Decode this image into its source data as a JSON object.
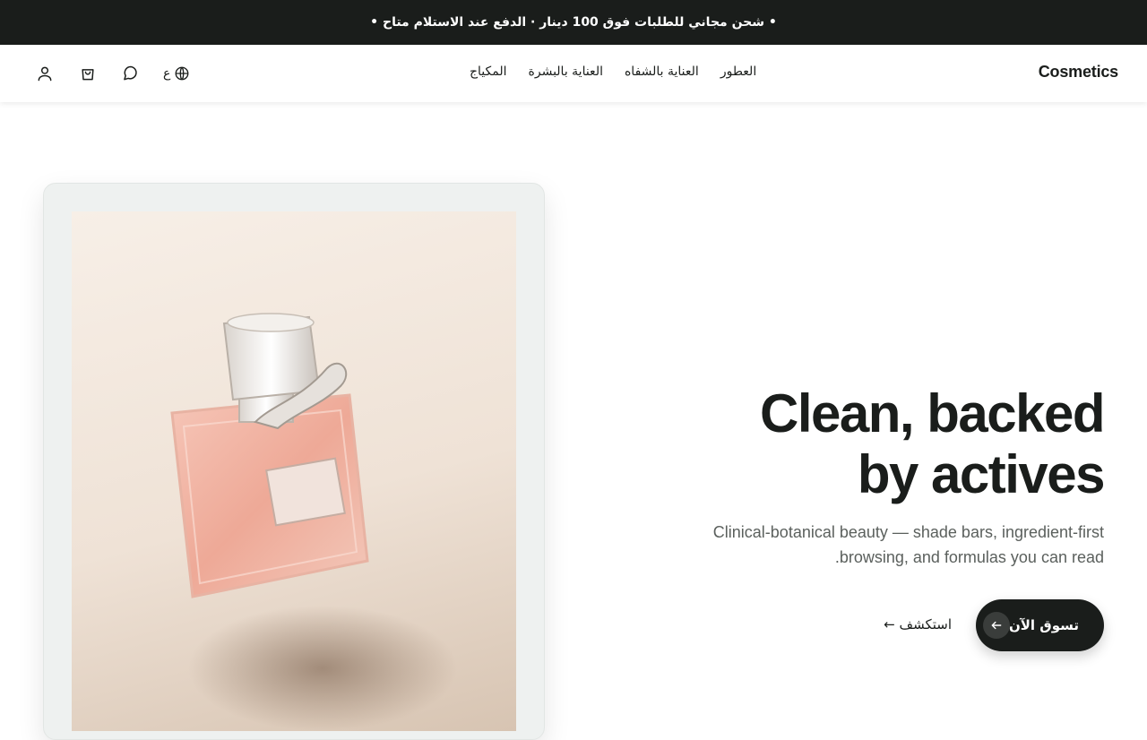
{
  "announcement": "• شحن مجاني للطلبات فوق 100 دينار · الدفع عند الاستلام متاح •",
  "brand": "Cosmetics",
  "nav": {
    "makeup": "المكياج",
    "skincare": "العناية بالبشرة",
    "lipcare": "العناية بالشفاه",
    "fragrance": "العطور"
  },
  "toolbar": {
    "language_label": "ع",
    "icons": [
      "globe-icon",
      "chat-icon",
      "cart-icon",
      "user-icon"
    ]
  },
  "hero": {
    "title_line1": "Clean, backed",
    "title_line2": "by actives",
    "subtitle": "Clinical-botanical beauty — shade bars, ingredient-first browsing, and formulas you can read.",
    "cta_label": "تسوق الآن",
    "secondary_label": "استكشف ←"
  },
  "colors": {
    "dark": "#1a1d1b",
    "muted_text": "#5b605d",
    "card_bg": "#eef1f0",
    "photo_bg": "#f2e8de"
  }
}
